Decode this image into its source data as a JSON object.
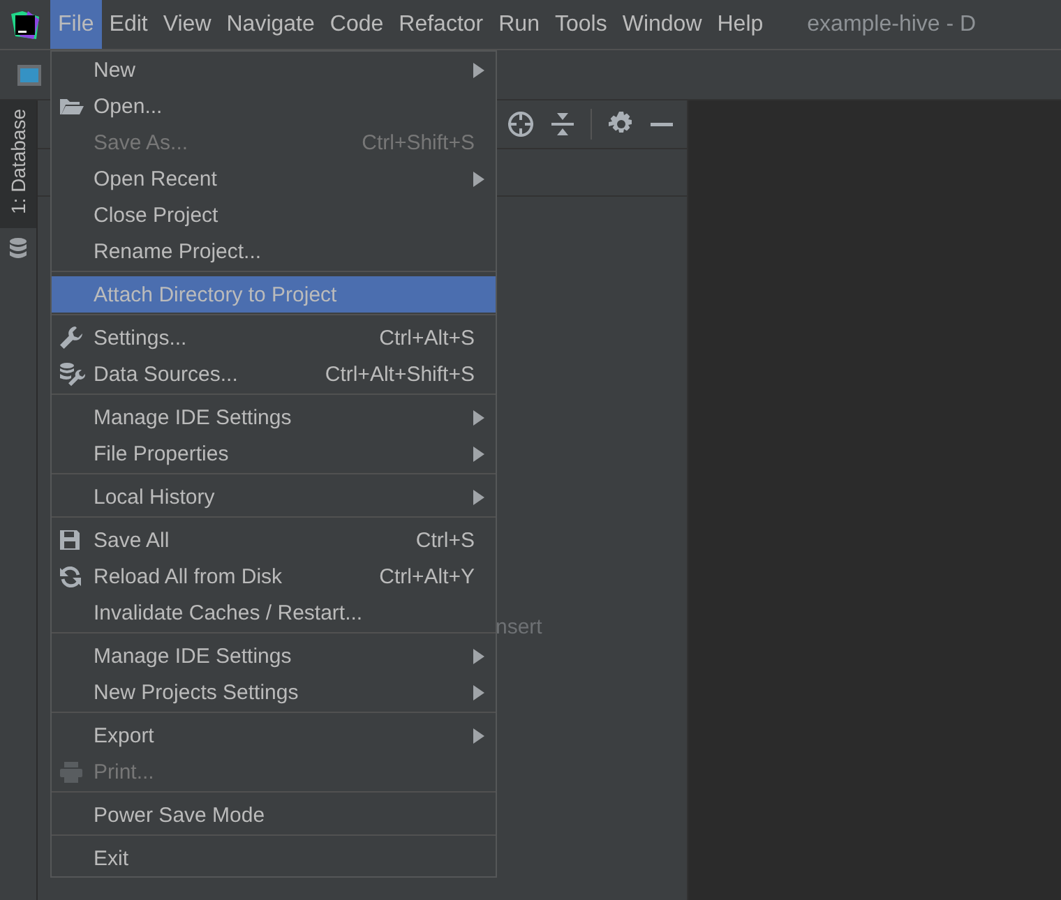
{
  "menubar": {
    "items": [
      {
        "label": "File",
        "selected": true
      },
      {
        "label": "Edit",
        "selected": false
      },
      {
        "label": "View",
        "selected": false
      },
      {
        "label": "Navigate",
        "selected": false
      },
      {
        "label": "Code",
        "selected": false
      },
      {
        "label": "Refactor",
        "selected": false
      },
      {
        "label": "Run",
        "selected": false
      },
      {
        "label": "Tools",
        "selected": false
      },
      {
        "label": "Window",
        "selected": false
      },
      {
        "label": "Help",
        "selected": false
      }
    ],
    "window_title": "example-hive - D"
  },
  "tool_strip": {
    "tab": "1: Database"
  },
  "editor": {
    "hint": "nsert"
  },
  "file_menu": {
    "groups": [
      [
        {
          "label": "New",
          "submenu": true,
          "disabled": false,
          "selected": false
        },
        {
          "label": "Open...",
          "submenu": false,
          "disabled": false,
          "selected": false
        },
        {
          "label": "Save As...",
          "shortcut": "Ctrl+Shift+S",
          "submenu": false,
          "disabled": true,
          "selected": false
        },
        {
          "label": "Open Recent",
          "submenu": true,
          "disabled": false,
          "selected": false
        },
        {
          "label": "Close Project",
          "submenu": false,
          "disabled": false,
          "selected": false
        },
        {
          "label": "Rename Project...",
          "submenu": false,
          "disabled": false,
          "selected": false
        }
      ],
      [
        {
          "label": "Attach Directory to Project",
          "submenu": false,
          "disabled": false,
          "selected": true
        }
      ],
      [
        {
          "label": "Settings...",
          "shortcut": "Ctrl+Alt+S",
          "submenu": false,
          "disabled": false,
          "selected": false
        },
        {
          "label": "Data Sources...",
          "shortcut": "Ctrl+Alt+Shift+S",
          "submenu": false,
          "disabled": false,
          "selected": false
        }
      ],
      [
        {
          "label": "Manage IDE Settings",
          "submenu": true,
          "disabled": false,
          "selected": false
        },
        {
          "label": "File Properties",
          "submenu": true,
          "disabled": false,
          "selected": false
        }
      ],
      [
        {
          "label": "Local History",
          "submenu": true,
          "disabled": false,
          "selected": false
        }
      ],
      [
        {
          "label": "Save All",
          "shortcut": "Ctrl+S",
          "submenu": false,
          "disabled": false,
          "selected": false
        },
        {
          "label": "Reload All from Disk",
          "shortcut": "Ctrl+Alt+Y",
          "submenu": false,
          "disabled": false,
          "selected": false
        },
        {
          "label": "Invalidate Caches / Restart...",
          "submenu": false,
          "disabled": false,
          "selected": false
        }
      ],
      [
        {
          "label": "Manage IDE Settings",
          "submenu": true,
          "disabled": false,
          "selected": false
        },
        {
          "label": "New Projects Settings",
          "submenu": true,
          "disabled": false,
          "selected": false
        }
      ],
      [
        {
          "label": "Export",
          "submenu": true,
          "disabled": false,
          "selected": false
        },
        {
          "label": "Print...",
          "submenu": false,
          "disabled": true,
          "selected": false
        }
      ],
      [
        {
          "label": "Power Save Mode",
          "submenu": false,
          "disabled": false,
          "selected": false
        }
      ],
      [
        {
          "label": "Exit",
          "submenu": false,
          "disabled": false,
          "selected": false
        }
      ]
    ]
  }
}
